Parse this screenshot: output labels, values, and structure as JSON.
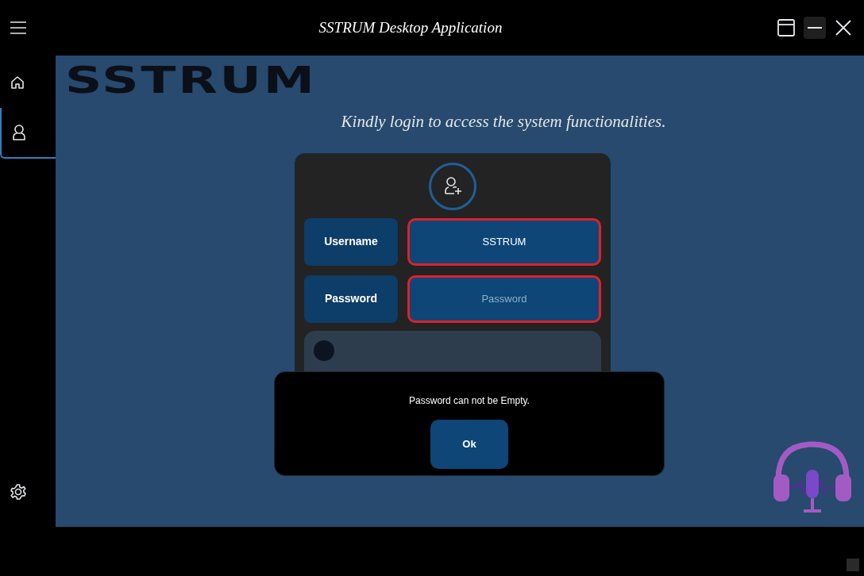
{
  "window": {
    "title": "SSTRUM Desktop Application"
  },
  "sidebar": {
    "items": [
      {
        "kind": "home",
        "selected": false
      },
      {
        "kind": "user",
        "selected": true
      },
      {
        "kind": "settings",
        "selected": false
      }
    ]
  },
  "logo": "SSTRUM",
  "subtitle": "Kindly login to access the system functionalities.",
  "form": {
    "fields": [
      {
        "label": "Username",
        "value": "SSTRUM",
        "error": true
      },
      {
        "label": "Password",
        "placeholder": "Password",
        "error": true
      }
    ]
  },
  "dialog": {
    "message": "Password can not be Empty.",
    "button": "Ok"
  }
}
